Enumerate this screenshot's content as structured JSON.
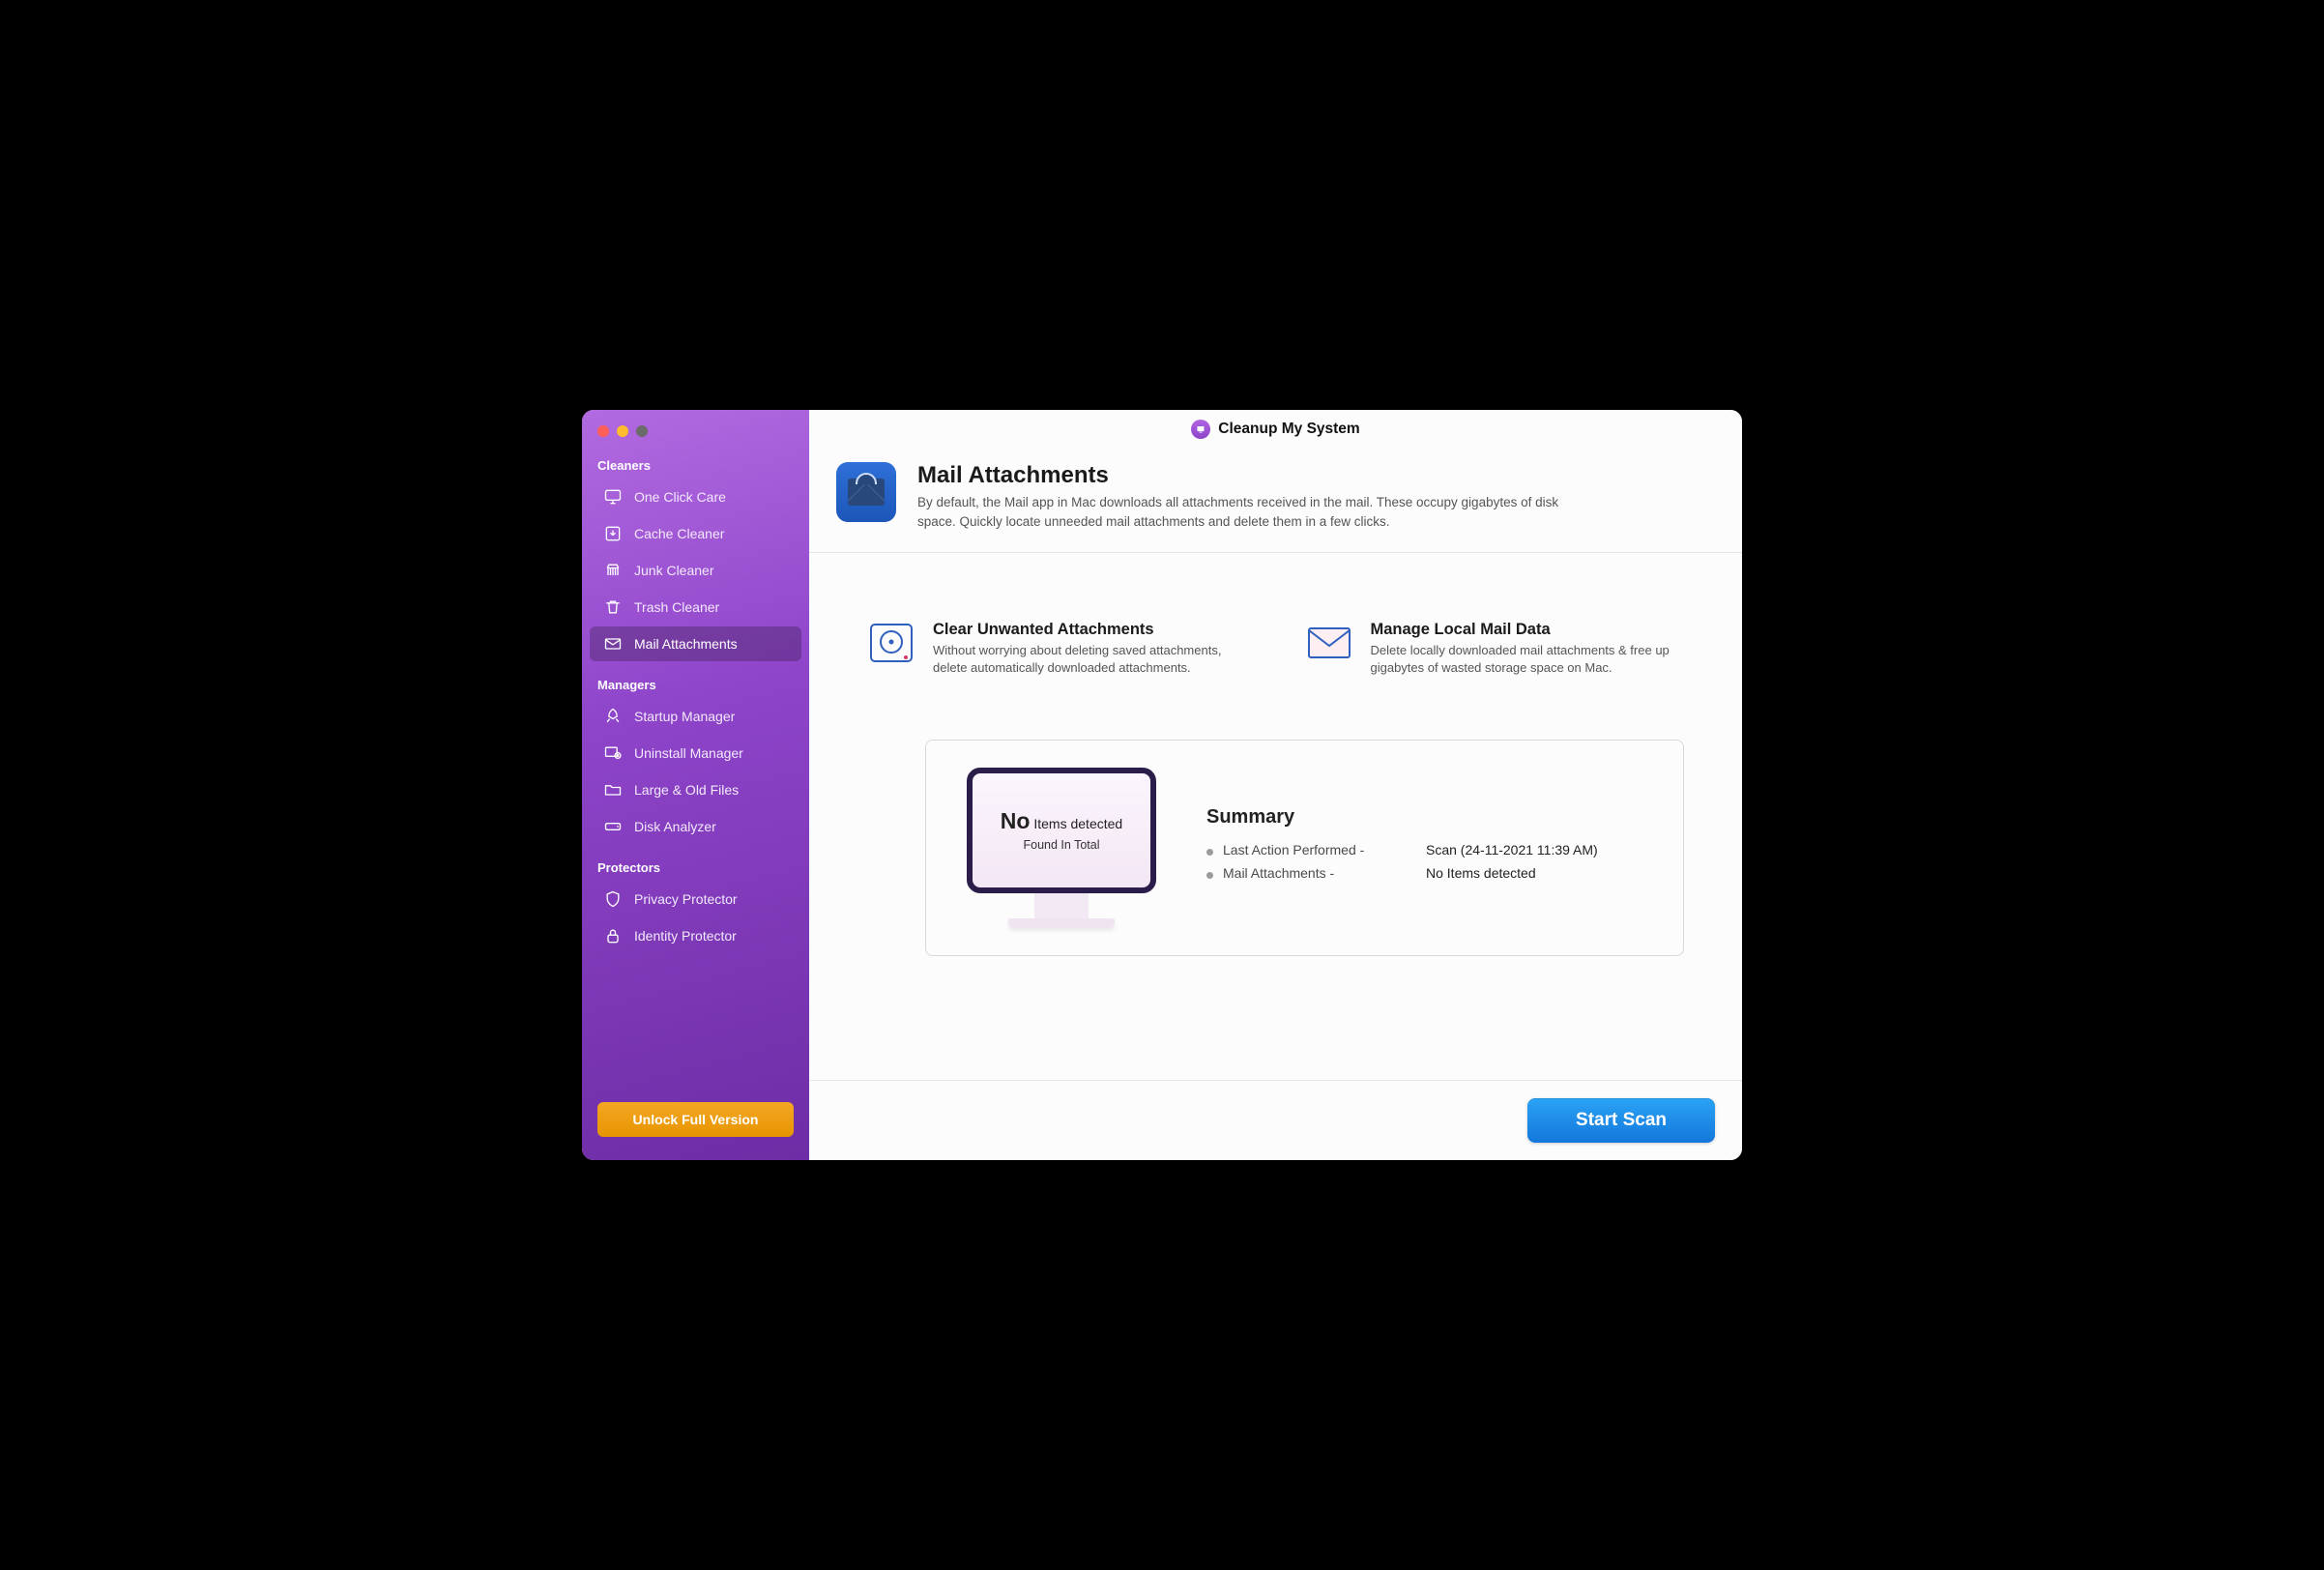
{
  "title": "Cleanup My System",
  "sidebar": {
    "sections": [
      {
        "label": "Cleaners",
        "items": [
          {
            "id": "one-click-care",
            "label": "One Click Care",
            "icon": "monitor-icon"
          },
          {
            "id": "cache-cleaner",
            "label": "Cache Cleaner",
            "icon": "download-box-icon"
          },
          {
            "id": "junk-cleaner",
            "label": "Junk Cleaner",
            "icon": "broom-icon"
          },
          {
            "id": "trash-cleaner",
            "label": "Trash Cleaner",
            "icon": "trash-icon"
          },
          {
            "id": "mail-attachments",
            "label": "Mail Attachments",
            "icon": "mail-icon",
            "selected": true
          }
        ]
      },
      {
        "label": "Managers",
        "items": [
          {
            "id": "startup-manager",
            "label": "Startup Manager",
            "icon": "rocket-icon"
          },
          {
            "id": "uninstall-manager",
            "label": "Uninstall Manager",
            "icon": "uninstall-icon"
          },
          {
            "id": "large-old-files",
            "label": "Large & Old Files",
            "icon": "folder-icon"
          },
          {
            "id": "disk-analyzer",
            "label": "Disk Analyzer",
            "icon": "disk-icon"
          }
        ]
      },
      {
        "label": "Protectors",
        "items": [
          {
            "id": "privacy-protector",
            "label": "Privacy Protector",
            "icon": "shield-icon"
          },
          {
            "id": "identity-protector",
            "label": "Identity Protector",
            "icon": "lock-icon"
          }
        ]
      }
    ],
    "unlock_label": "Unlock Full Version"
  },
  "header": {
    "title": "Mail Attachments",
    "description": "By default, the Mail app in Mac downloads all attachments received in the mail. These occupy gigabytes of disk space. Quickly locate unneeded mail attachments and delete them in a few clicks."
  },
  "features": [
    {
      "id": "clear-unwanted",
      "title": "Clear Unwanted Attachments",
      "description": "Without worrying about deleting saved attachments, delete automatically downloaded attachments.",
      "icon": "hdd-icon"
    },
    {
      "id": "manage-local",
      "title": "Manage Local Mail Data",
      "description": "Delete locally downloaded mail attachments & free up gigabytes of wasted storage space on Mac.",
      "icon": "envelope-icon"
    }
  ],
  "summary": {
    "title": "Summary",
    "monitor_big": "No",
    "monitor_rest": " Items detected",
    "monitor_sub": "Found In Total",
    "rows": [
      {
        "label": "Last Action Performed -",
        "value": "Scan (24-11-2021 11:39 AM)"
      },
      {
        "label": "Mail Attachments -",
        "value": "No Items detected"
      }
    ]
  },
  "footer": {
    "scan_label": "Start Scan"
  }
}
